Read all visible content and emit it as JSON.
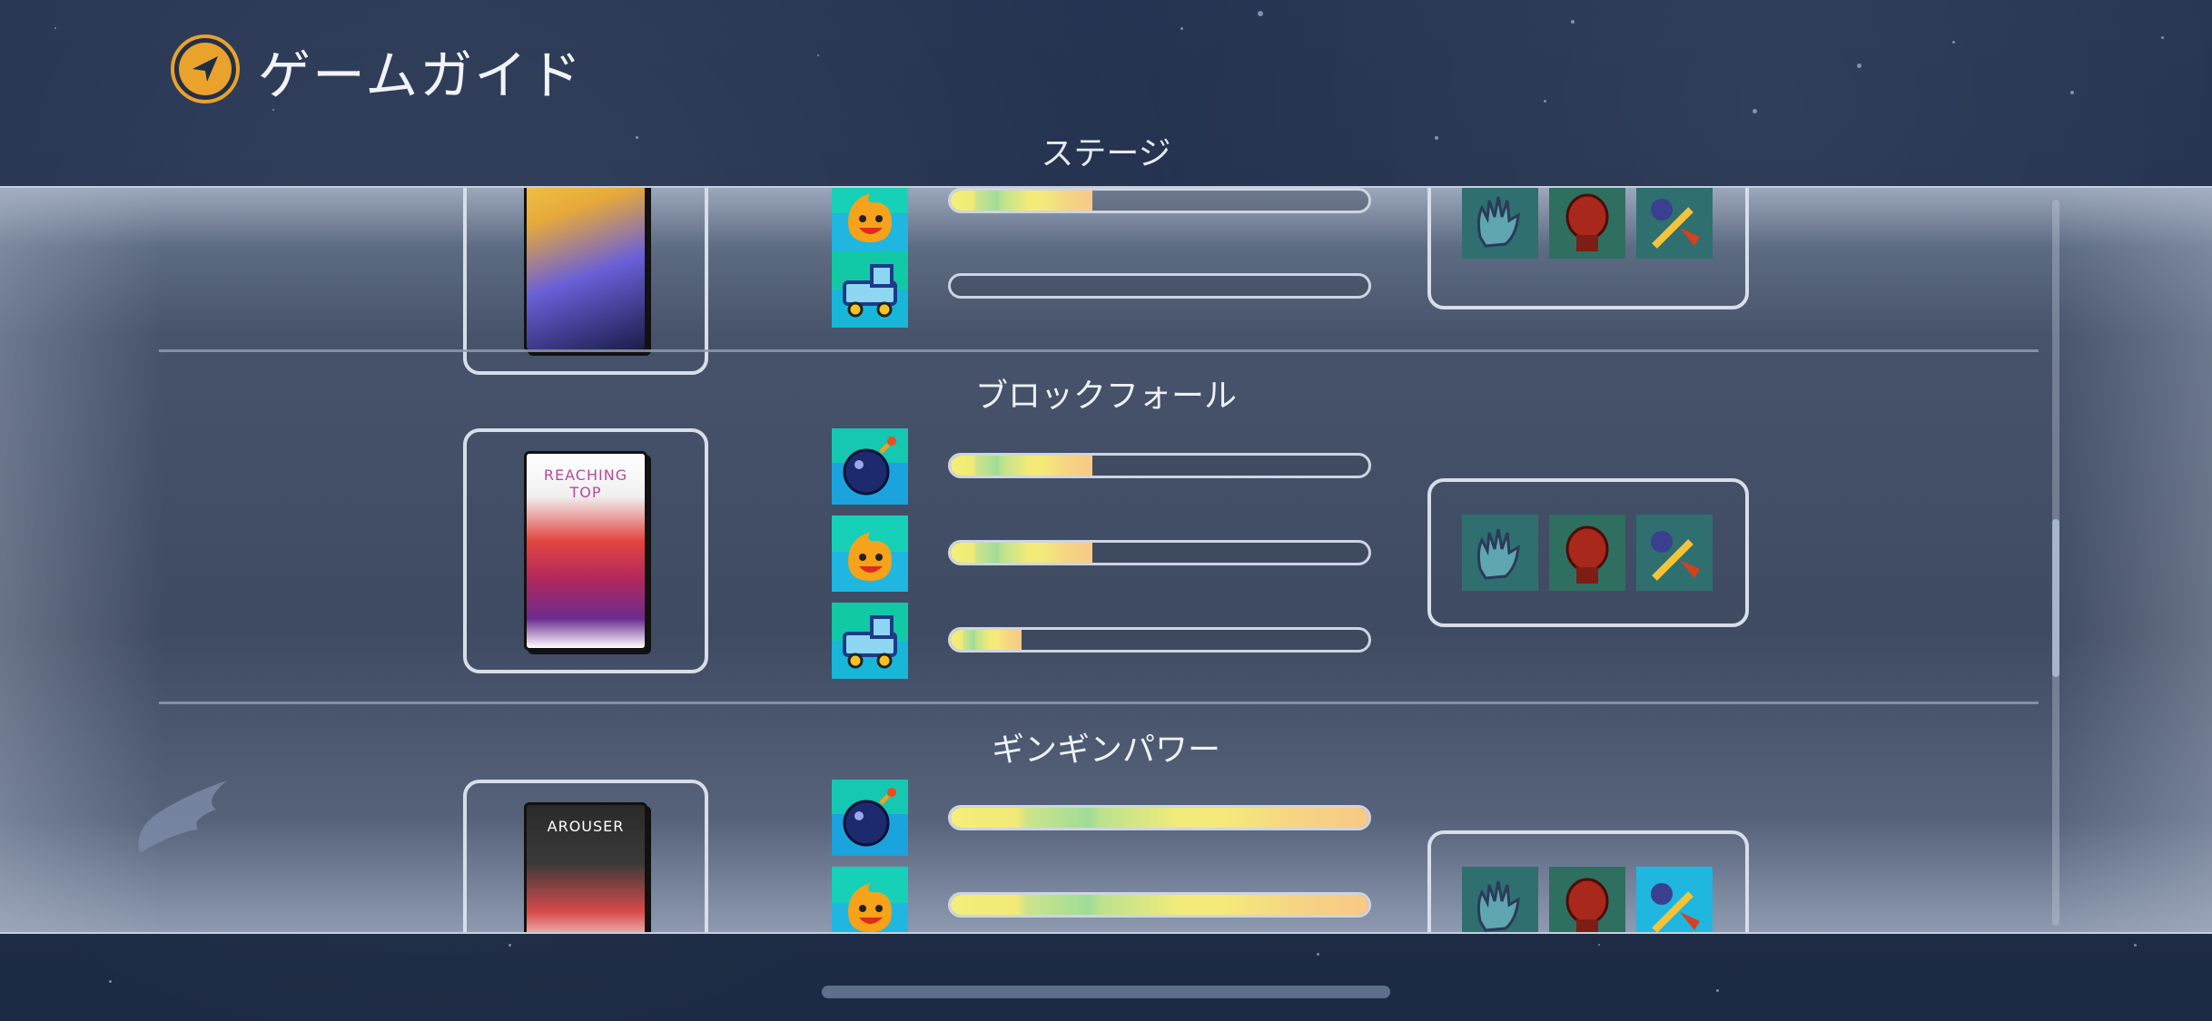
{
  "header": {
    "title": "ゲームガイド",
    "tab": "ステージ"
  },
  "sections": [
    {
      "title": "",
      "cover": {
        "text": "",
        "colors": [
          "#f3d24b",
          "#6a5fd8",
          "#1b1d4a"
        ]
      },
      "rows": [
        {
          "icon": "flame-face-icon",
          "progress": 0.34
        },
        {
          "icon": "cart-icon",
          "progress": 0.0
        }
      ],
      "upgrades": [
        "glove-icon",
        "boxing-glove-icon",
        "mace-icon"
      ]
    },
    {
      "title": "ブロックフォール",
      "cover": {
        "text": "REACHING TOP",
        "colors": [
          "#ffffff",
          "#e2453f",
          "#6b2c8e"
        ]
      },
      "rows": [
        {
          "icon": "bomb-icon",
          "progress": 0.34
        },
        {
          "icon": "flame-face-icon",
          "progress": 0.34
        },
        {
          "icon": "cart-icon",
          "progress": 0.17
        }
      ],
      "upgrades": [
        "glove-icon",
        "boxing-glove-icon",
        "mace-icon"
      ]
    },
    {
      "title": "ギンギンパワー",
      "cover": {
        "text": "AROUSER",
        "colors": [
          "#2a2a2a",
          "#d84a4a",
          "#f6dede"
        ]
      },
      "rows": [
        {
          "icon": "bomb-icon",
          "progress": 1.0
        },
        {
          "icon": "flame-face-icon",
          "progress": 1.0
        }
      ],
      "upgrades": [
        "glove-icon",
        "boxing-glove-icon",
        "mace-icon"
      ]
    }
  ]
}
